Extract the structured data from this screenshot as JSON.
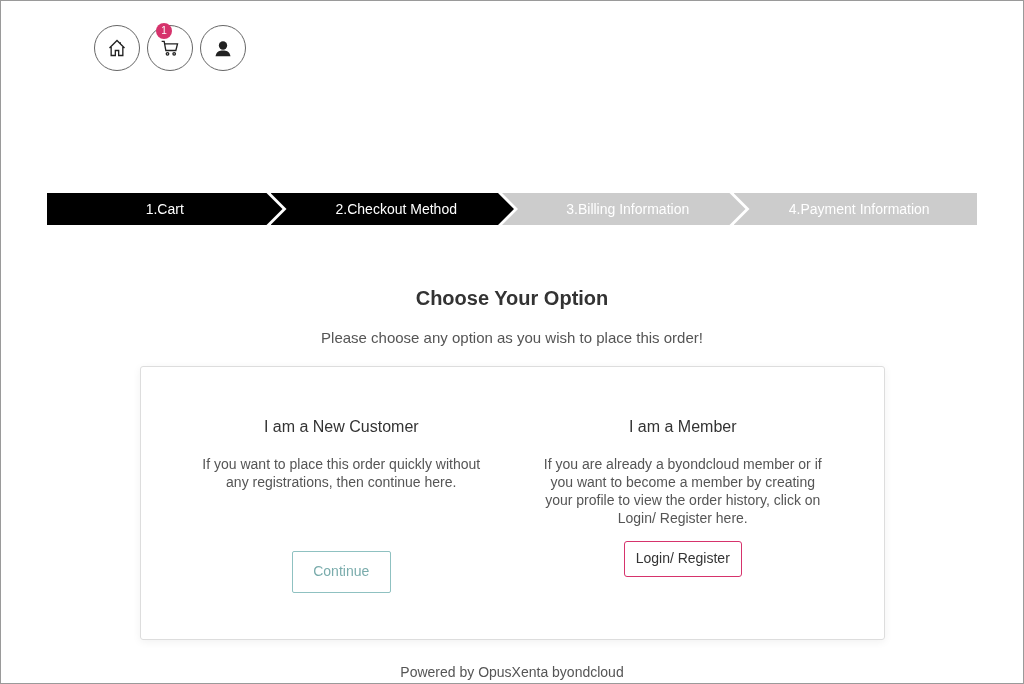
{
  "header_icons": [
    {
      "kind": "home"
    },
    {
      "kind": "cart",
      "badge": "1"
    },
    {
      "kind": "user"
    }
  ],
  "steps": [
    {
      "label": "1.Cart",
      "active": true
    },
    {
      "label": "2.Checkout Method",
      "active": true
    },
    {
      "label": "3.Billing Information",
      "active": false
    },
    {
      "label": "4.Payment Information",
      "active": false
    }
  ],
  "heading": "Choose Your Option",
  "subtitle": "Please choose any option as you wish to place this order!",
  "options": [
    {
      "title": "I am a New Customer",
      "text": "If you want to place this order quickly without any registrations, then continue here.",
      "button": "Continue",
      "kind": "continue"
    },
    {
      "title": "I am a Member",
      "text": "If you are already a byondcloud member or if you want to become a member by creating your profile to view the order history, click on Login/ Register here.",
      "button": "Login/ Register",
      "kind": "login"
    }
  ],
  "footer": "Powered by OpusXenta byondcloud"
}
